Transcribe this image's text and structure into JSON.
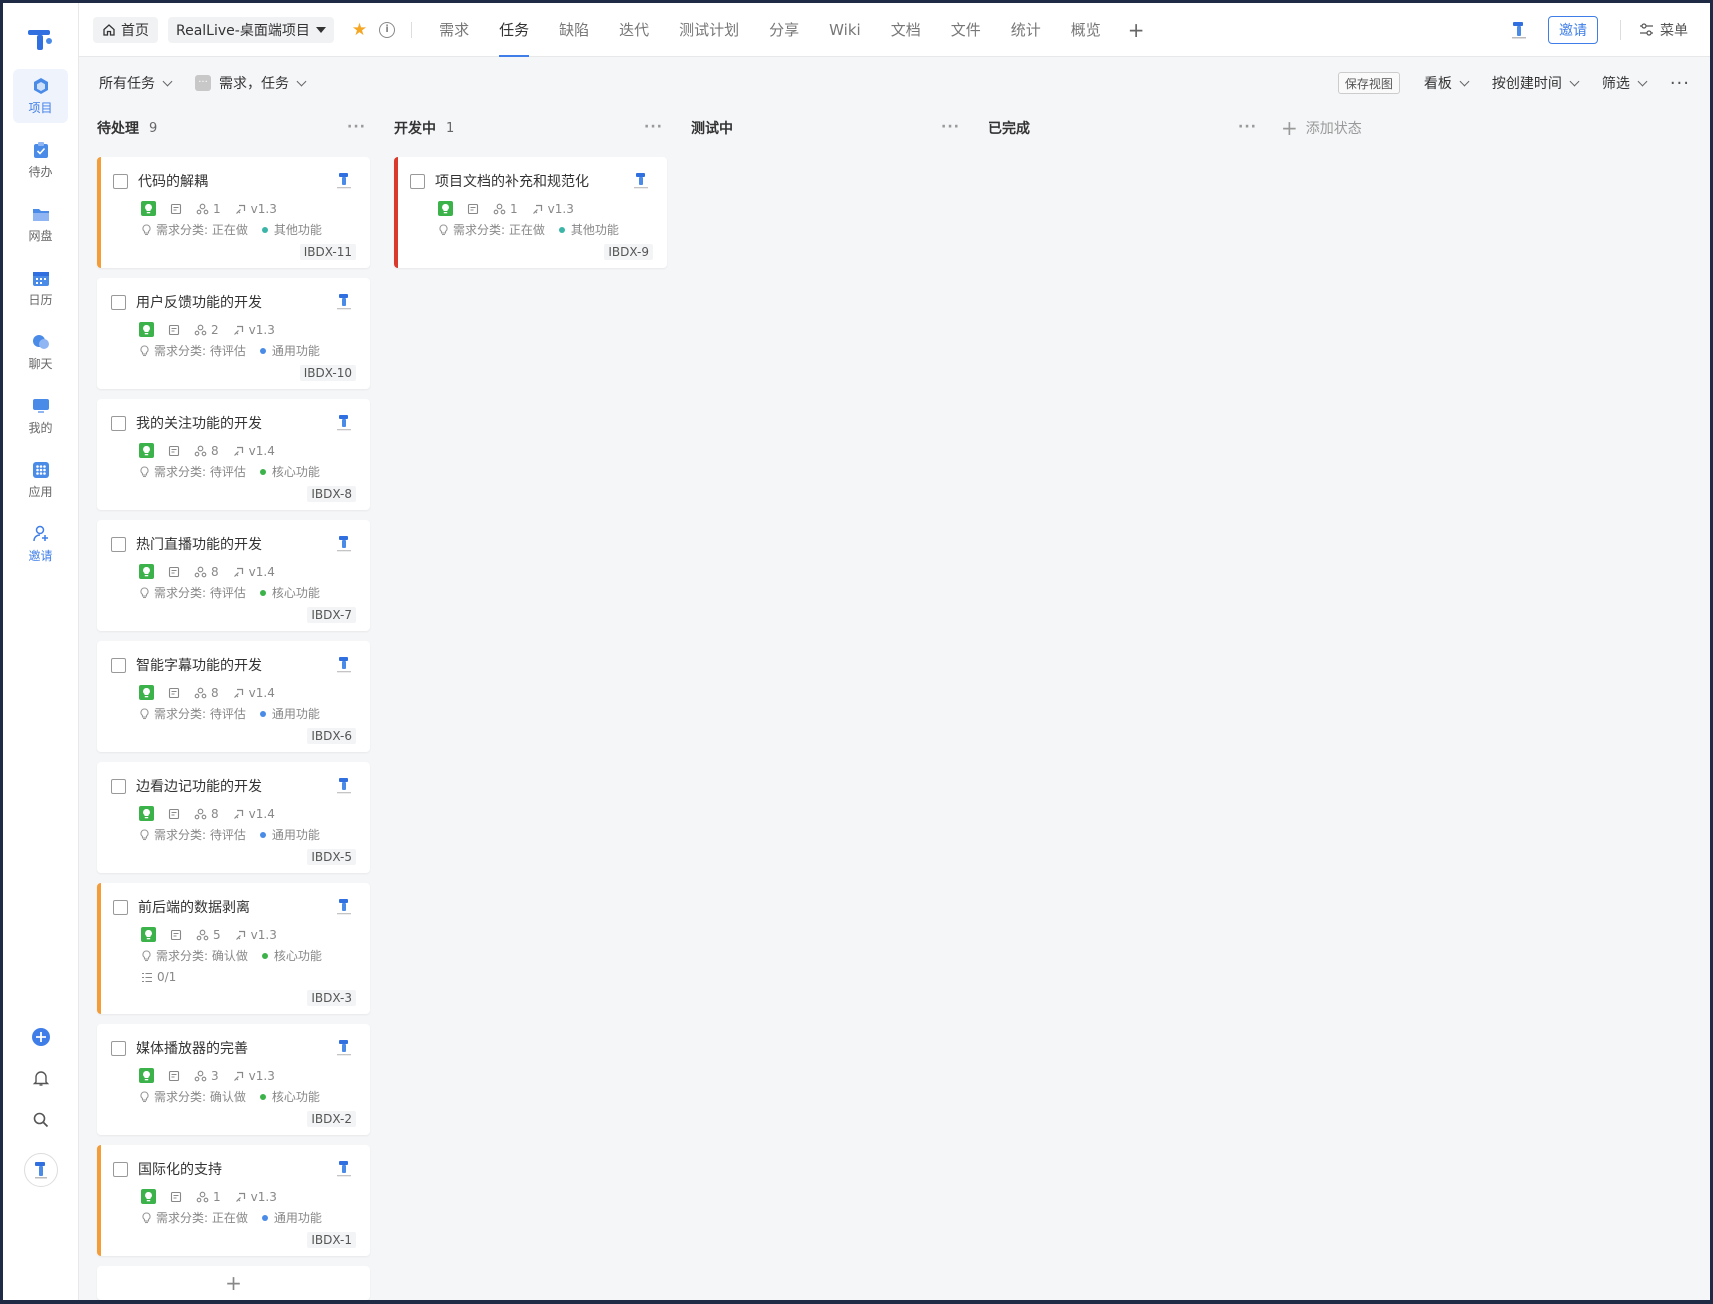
{
  "rail": {
    "items": [
      {
        "label": "项目",
        "icon": "project-icon",
        "active": true
      },
      {
        "label": "待办",
        "icon": "todo-icon"
      },
      {
        "label": "网盘",
        "icon": "netdisk-icon"
      },
      {
        "label": "日历",
        "icon": "calendar-icon"
      },
      {
        "label": "聊天",
        "icon": "chat-icon"
      },
      {
        "label": "我的",
        "icon": "monitor-icon"
      },
      {
        "label": "应用",
        "icon": "apps-icon"
      },
      {
        "label": "邀请",
        "icon": "invite-user-icon"
      }
    ]
  },
  "topbar": {
    "home_label": "首页",
    "project_name": "RealLive-桌面端项目",
    "tabs": [
      "需求",
      "任务",
      "缺陷",
      "迭代",
      "测试计划",
      "分享",
      "Wiki",
      "文档",
      "文件",
      "统计",
      "概览"
    ],
    "active_tab": "任务",
    "add_tab": "+",
    "invite_label": "邀请",
    "menu_label": "菜单"
  },
  "toolbar": {
    "scope_label": "所有任务",
    "type_label": "需求，任务",
    "save_view_label": "保存视图",
    "view_label": "看板",
    "sort_label": "按创建时间",
    "filter_label": "筛选"
  },
  "colors": {
    "accent": "#3f7ee8",
    "bar_orange": "#f39c38",
    "bar_red": "#d93a2b",
    "badge_green": "#3cb34a",
    "dot_teal": "#3ab5a8",
    "dot_blue": "#4a8be8",
    "dot_green": "#3cb34a"
  },
  "board": {
    "columns": [
      {
        "title": "待处理",
        "count": "9"
      },
      {
        "title": "开发中",
        "count": "1"
      },
      {
        "title": "测试中",
        "count": ""
      },
      {
        "title": "已完成",
        "count": ""
      }
    ],
    "add_status_label": "添加状态",
    "add_card_label": "+",
    "cards_todo": [
      {
        "title": "代码的解耦",
        "members": "1",
        "version": "v1.3",
        "category": "需求分类: 正在做",
        "module": "其他功能",
        "id": "IBDX-11",
        "bar": "orange",
        "dot": "teal"
      },
      {
        "title": "用户反馈功能的开发",
        "members": "2",
        "version": "v1.3",
        "category": "需求分类: 待评估",
        "module": "通用功能",
        "id": "IBDX-10",
        "bar": "",
        "dot": "blue"
      },
      {
        "title": "我的关注功能的开发",
        "members": "8",
        "version": "v1.4",
        "category": "需求分类: 待评估",
        "module": "核心功能",
        "id": "IBDX-8",
        "bar": "",
        "dot": "green"
      },
      {
        "title": "热门直播功能的开发",
        "members": "8",
        "version": "v1.4",
        "category": "需求分类: 待评估",
        "module": "核心功能",
        "id": "IBDX-7",
        "bar": "",
        "dot": "green"
      },
      {
        "title": "智能字幕功能的开发",
        "members": "8",
        "version": "v1.4",
        "category": "需求分类: 待评估",
        "module": "通用功能",
        "id": "IBDX-6",
        "bar": "",
        "dot": "blue"
      },
      {
        "title": "边看边记功能的开发",
        "members": "8",
        "version": "v1.4",
        "category": "需求分类: 待评估",
        "module": "通用功能",
        "id": "IBDX-5",
        "bar": "",
        "dot": "blue"
      },
      {
        "title": "前后端的数据剥离",
        "members": "5",
        "version": "v1.3",
        "category": "需求分类: 确认做",
        "module": "核心功能",
        "id": "IBDX-3",
        "bar": "orange",
        "dot": "green",
        "subtasks": "0/1"
      },
      {
        "title": "媒体播放器的完善",
        "members": "3",
        "version": "v1.3",
        "category": "需求分类: 确认做",
        "module": "核心功能",
        "id": "IBDX-2",
        "bar": "",
        "dot": "green"
      },
      {
        "title": "国际化的支持",
        "members": "1",
        "version": "v1.3",
        "category": "需求分类: 正在做",
        "module": "通用功能",
        "id": "IBDX-1",
        "bar": "orange",
        "dot": "blue"
      }
    ],
    "cards_dev": [
      {
        "title": "项目文档的补充和规范化",
        "members": "1",
        "version": "v1.3",
        "category": "需求分类: 正在做",
        "module": "其他功能",
        "id": "IBDX-9",
        "bar": "red",
        "dot": "teal"
      }
    ]
  }
}
